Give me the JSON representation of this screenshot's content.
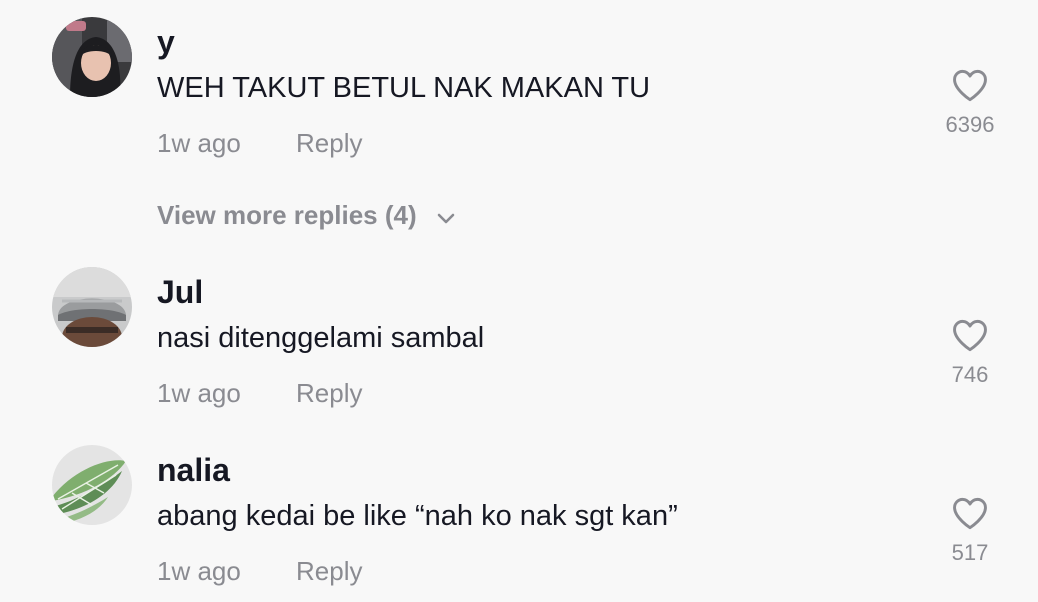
{
  "comments": [
    {
      "username": "y",
      "text": "WEH TAKUT BETUL NAK MAKAN TU",
      "time": "1w ago",
      "reply_label": "Reply",
      "likes": "6396",
      "view_more": "View more replies (4)"
    },
    {
      "username": "Jul",
      "text": "nasi ditenggelami sambal",
      "time": "1w ago",
      "reply_label": "Reply",
      "likes": "746"
    },
    {
      "username": "nalia",
      "text": "abang kedai be like “nah ko nak sgt kan”",
      "time": "1w ago",
      "reply_label": "Reply",
      "likes": "517"
    }
  ],
  "icons": {
    "like": "heart-outline-icon",
    "expand": "chevron-down-icon"
  }
}
